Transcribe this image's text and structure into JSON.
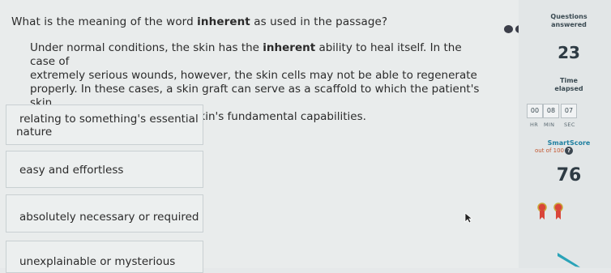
{
  "question": {
    "prefix": "What is the meaning of the word ",
    "word": "inherent",
    "suffix": " as used in the passage?"
  },
  "passage": {
    "line1_pre": "Under normal conditions, the skin has the ",
    "word": "inherent",
    "line1_post": " ability to heal itself. In the case of",
    "line2": "extremely serious wounds, however, the skin cells may not be able to regenerate",
    "line3": "properly. In these cases, a skin graft can serve as a scaffold to which the patient's skin",
    "line4": "cells attach, encouraging the skin's fundamental capabilities."
  },
  "choices": [
    {
      "line1": "relating to something's essential",
      "line2": "nature"
    },
    {
      "line1": "easy and effortless"
    },
    {
      "line1": "absolutely necessary or required"
    },
    {
      "line1": "unexplainable or mysterious"
    }
  ],
  "sidebar": {
    "questions_label_1": "Questions",
    "questions_label_2": "answered",
    "questions_count": "23",
    "time_label_1": "Time",
    "time_label_2": "elapsed",
    "time_hr": "00",
    "time_min": "08",
    "time_sec": "07",
    "hr_label": "HR",
    "min_label": "MIN",
    "sec_label": "SEC",
    "smartscore_label": "SmartScore",
    "smartscore_sub": "out of 100",
    "help_glyph": "?",
    "smartscore_value": "76"
  },
  "colors": {
    "ribbon": "#d9463a",
    "ribbon_ring": "#c9a83a",
    "pencil": "#2aa3b8",
    "smartscore_label": "#1e7fa0",
    "smartscore_sub": "#c2542e"
  },
  "icons": [
    "progress-dots-icon",
    "help-icon",
    "award-ribbon-icon",
    "pencil-icon",
    "mouse-cursor-icon"
  ]
}
